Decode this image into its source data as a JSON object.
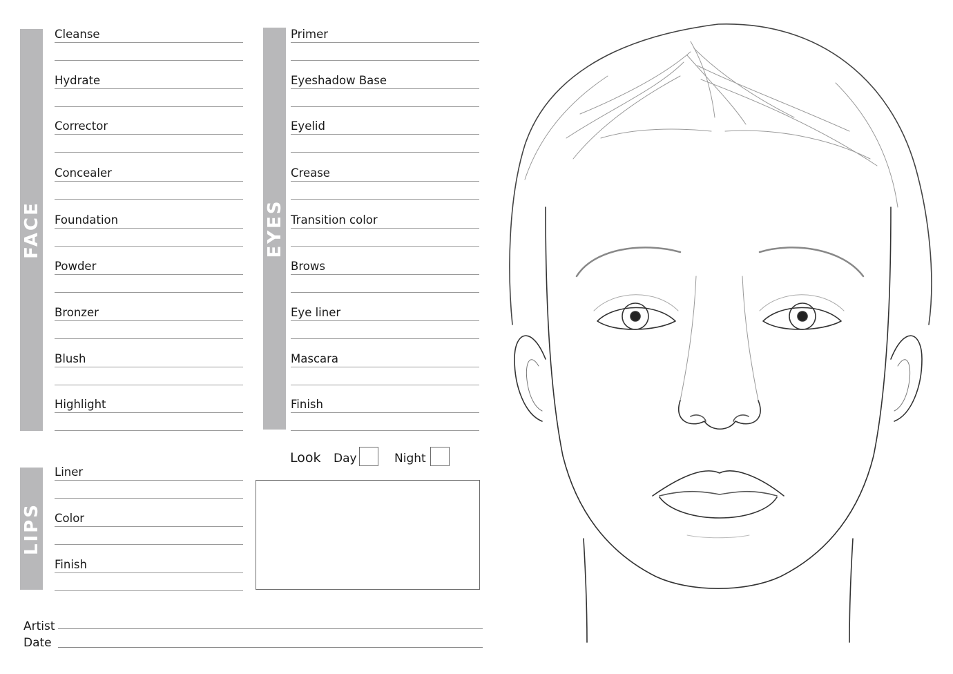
{
  "face_section": {
    "title": "FACE",
    "fields": [
      "Cleanse",
      "Hydrate",
      "Corrector",
      "Concealer",
      "Foundation",
      "Powder",
      "Bronzer",
      "Blush",
      "Highlight"
    ]
  },
  "eyes_section": {
    "title": "EYES",
    "fields": [
      "Primer",
      "Eyeshadow Base",
      "Eyelid",
      "Crease",
      "Transition color",
      "Brows",
      "Eye liner",
      "Mascara",
      "Finish"
    ]
  },
  "lips_section": {
    "title": "LIPS",
    "fields": [
      "Liner",
      "Color",
      "Finish"
    ]
  },
  "look": {
    "label": "Look",
    "day_label": "Day",
    "night_label": "Night",
    "day_checked": false,
    "night_checked": false
  },
  "signature": {
    "artist_label": "Artist",
    "date_label": "Date"
  },
  "colors": {
    "section_bar": "#b8b8ba",
    "rule": "#9a9a9a",
    "sketch_line": "#333333"
  }
}
